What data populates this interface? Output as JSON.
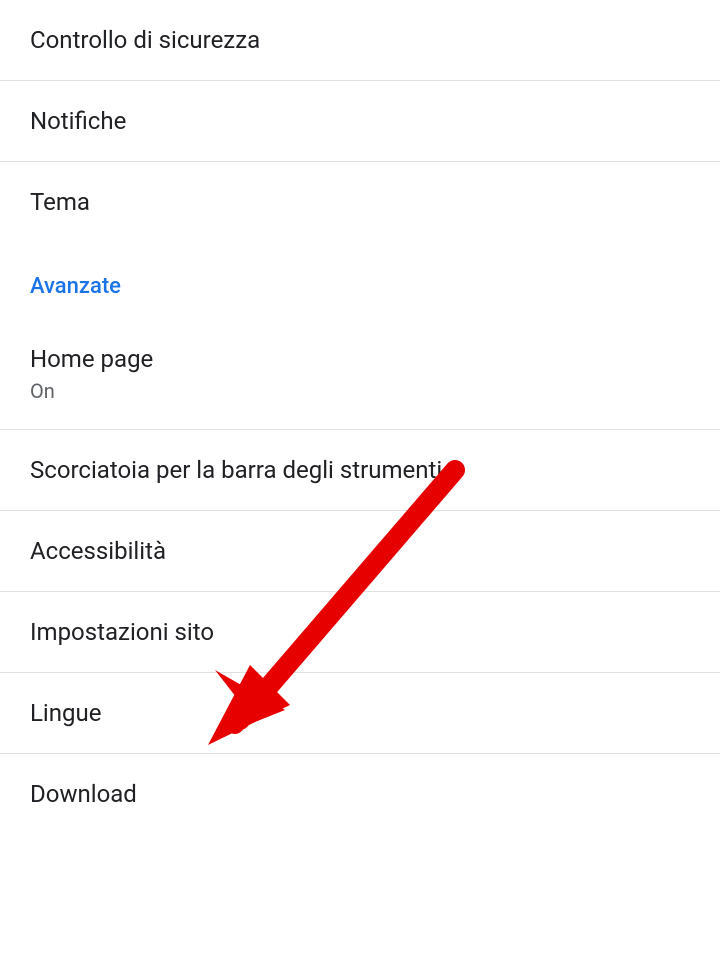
{
  "settings": {
    "items": [
      {
        "title": "Controllo di sicurezza",
        "subtitle": null
      },
      {
        "title": "Notifiche",
        "subtitle": null
      },
      {
        "title": "Tema",
        "subtitle": null
      }
    ],
    "section_header": "Avanzate",
    "advanced_items": [
      {
        "title": "Home page",
        "subtitle": "On"
      },
      {
        "title": "Scorciatoia per la barra degli strumenti",
        "subtitle": null
      },
      {
        "title": "Accessibilità",
        "subtitle": null
      },
      {
        "title": "Impostazioni sito",
        "subtitle": null
      },
      {
        "title": "Lingue",
        "subtitle": null
      },
      {
        "title": "Download",
        "subtitle": null
      }
    ]
  },
  "annotation": {
    "arrow_color": "#e60000"
  }
}
